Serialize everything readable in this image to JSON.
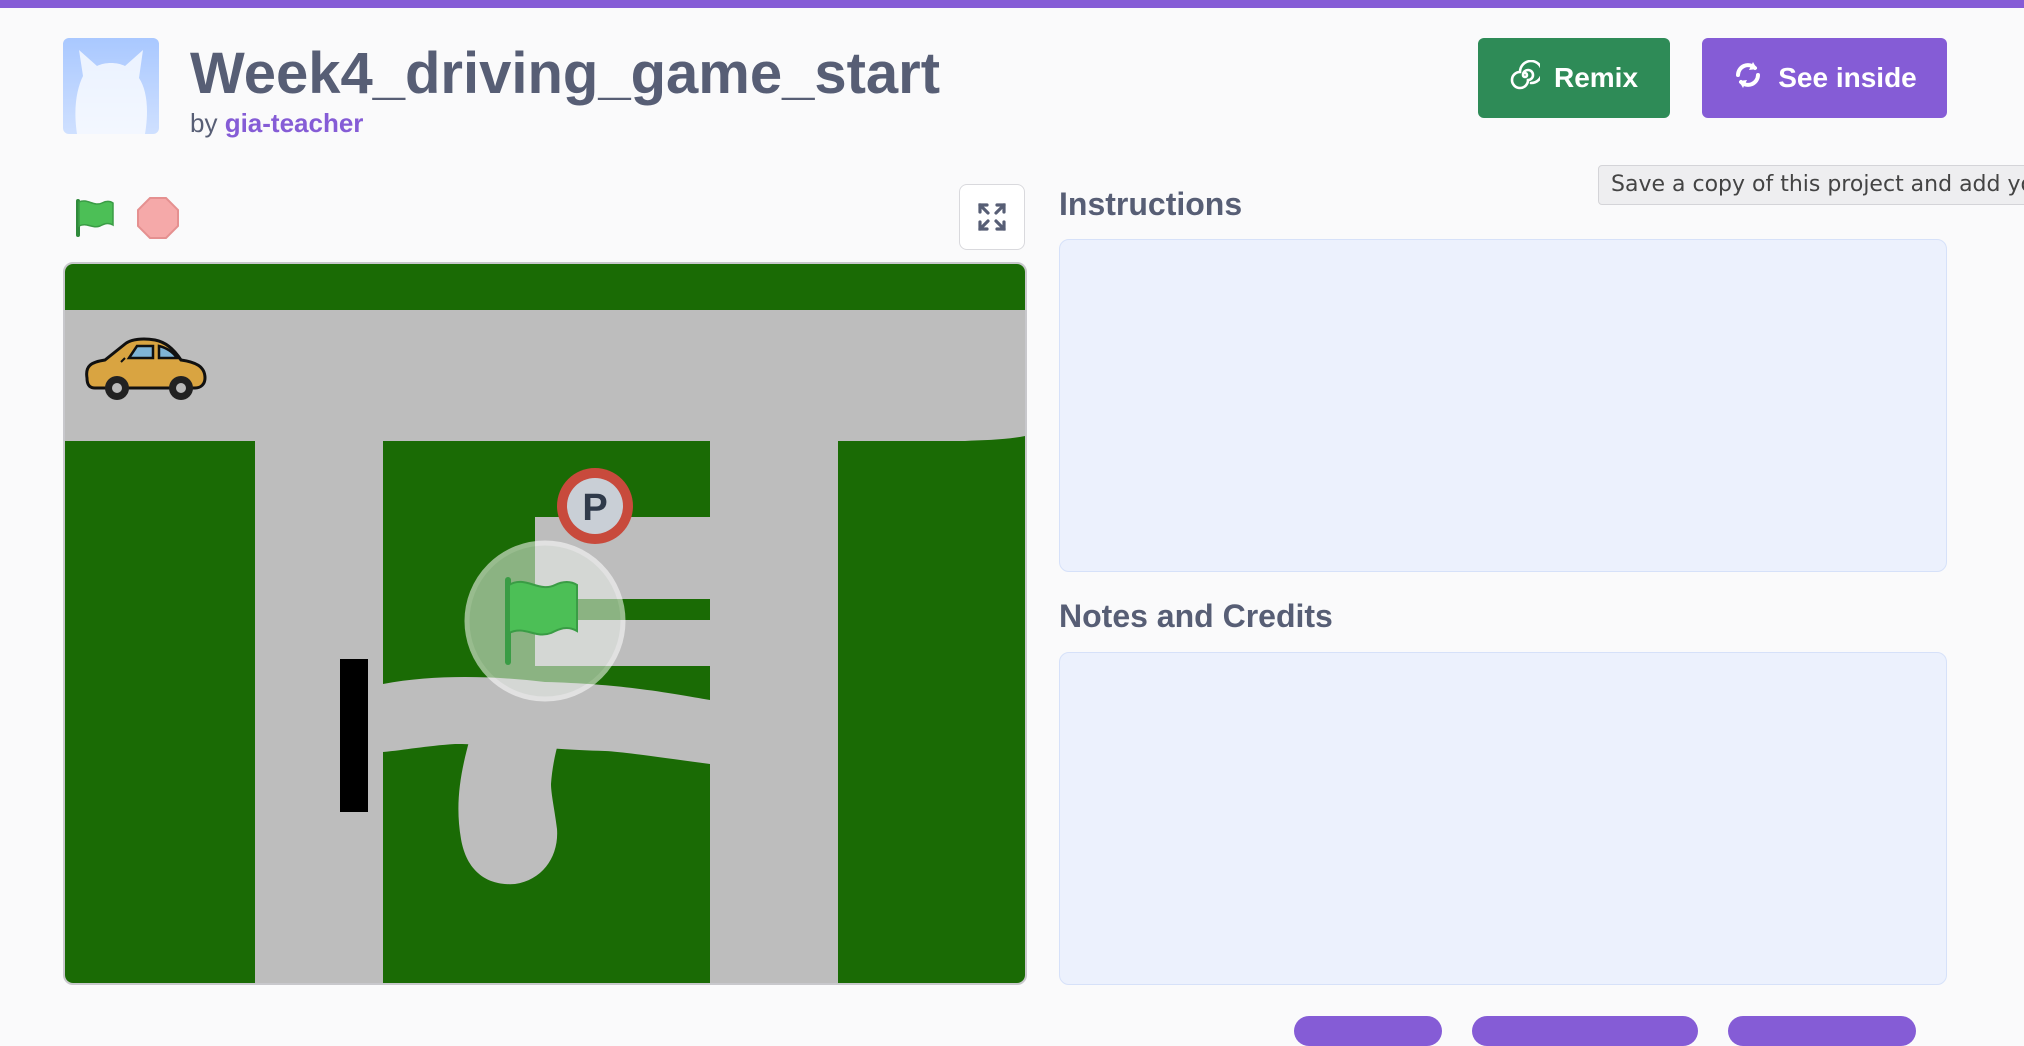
{
  "project": {
    "title": "Week4_driving_game_start",
    "by_prefix": "by",
    "author": "gia-teacher"
  },
  "actions": {
    "remix_label": "Remix",
    "see_inside_label": "See inside"
  },
  "tooltip": {
    "text": "Save a copy of this project and add you"
  },
  "stage": {
    "parking_sign_letter": "P"
  },
  "sections": {
    "instructions_label": "Instructions",
    "instructions_text": "",
    "notes_label": "Notes and Credits",
    "notes_text": ""
  },
  "colors": {
    "accent": "#855cd6",
    "remix": "#2e8b57",
    "grass": "#1a6b05",
    "road": "#bdbdbd"
  }
}
